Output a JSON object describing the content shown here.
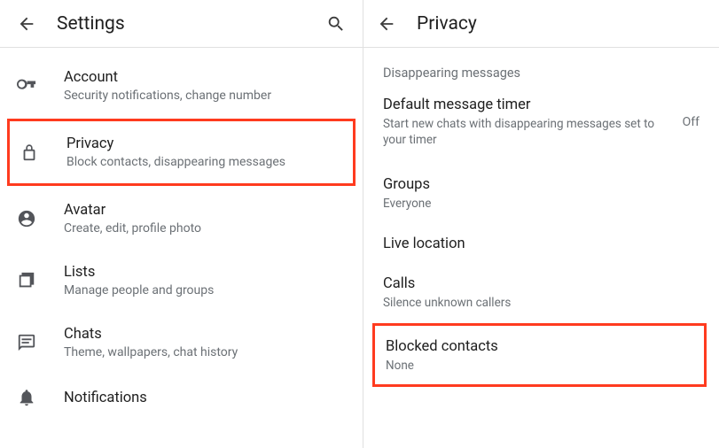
{
  "left": {
    "title": "Settings",
    "items": [
      {
        "title": "Account",
        "sub": "Security notifications, change number"
      },
      {
        "title": "Privacy",
        "sub": "Block contacts, disappearing messages"
      },
      {
        "title": "Avatar",
        "sub": "Create, edit, profile photo"
      },
      {
        "title": "Lists",
        "sub": "Manage people and groups"
      },
      {
        "title": "Chats",
        "sub": "Theme, wallpapers, chat history"
      },
      {
        "title": "Notifications",
        "sub": ""
      }
    ]
  },
  "right": {
    "title": "Privacy",
    "section_label": "Disappearing messages",
    "default_timer": {
      "title": "Default message timer",
      "sub": "Start new chats with disappearing messages set to your timer",
      "value": "Off"
    },
    "groups": {
      "title": "Groups",
      "sub": "Everyone"
    },
    "live_location": {
      "title": "Live location"
    },
    "calls": {
      "title": "Calls",
      "sub": "Silence unknown callers"
    },
    "blocked": {
      "title": "Blocked contacts",
      "sub": "None"
    }
  }
}
